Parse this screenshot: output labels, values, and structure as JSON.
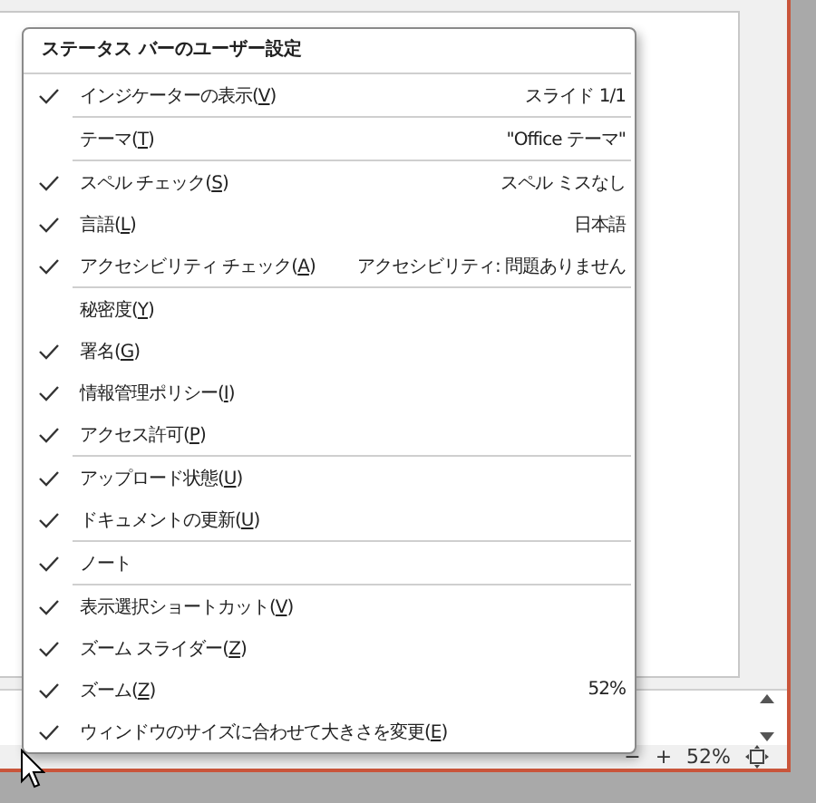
{
  "menu": {
    "title": "ステータス バーのユーザー設定",
    "groups": [
      {
        "items": [
          {
            "before": "インジケーターの表示(",
            "key": "V",
            "after": ")",
            "checked": true,
            "value": "スライド 1/1"
          }
        ]
      },
      {
        "items": [
          {
            "before": "テーマ(",
            "key": "T",
            "after": ")",
            "checked": false,
            "value": "\"Office テーマ\""
          }
        ]
      },
      {
        "items": [
          {
            "before": "スペル チェック(",
            "key": "S",
            "after": ")",
            "checked": true,
            "value": "スペル ミスなし"
          },
          {
            "before": "言語(",
            "key": "L",
            "after": ")",
            "checked": true,
            "value": "日本語"
          },
          {
            "before": "アクセシビリティ チェック(",
            "key": "A",
            "after": ")",
            "checked": true,
            "value": "アクセシビリティ: 問題ありません"
          }
        ]
      },
      {
        "items": [
          {
            "before": "秘密度(",
            "key": "Y",
            "after": ")",
            "checked": false
          },
          {
            "before": "署名(",
            "key": "G",
            "after": ")",
            "checked": true
          },
          {
            "before": "情報管理ポリシー(",
            "key": "I",
            "after": ")",
            "checked": true
          },
          {
            "before": "アクセス許可(",
            "key": "P",
            "after": ")",
            "checked": true
          }
        ]
      },
      {
        "items": [
          {
            "before": "アップロード状態(",
            "key": "U",
            "after": ")",
            "checked": true
          },
          {
            "before": "ドキュメントの更新(",
            "key": "U",
            "after": ")",
            "checked": true
          }
        ]
      },
      {
        "items": [
          {
            "before": "ノート",
            "checked": true
          }
        ]
      },
      {
        "items": [
          {
            "before": "表示選択ショートカット(",
            "key": "V",
            "after": ")",
            "checked": true
          },
          {
            "before": "ズーム スライダー(",
            "key": "Z",
            "after": ")",
            "checked": true
          },
          {
            "before": "ズーム(",
            "key": "Z",
            "after": ")",
            "checked": true,
            "value": "52%"
          },
          {
            "before": "ウィンドウのサイズに合わせて大きさを変更(",
            "key": "E",
            "after": ")",
            "checked": true
          }
        ]
      }
    ]
  },
  "status_bar": {
    "zoom_minus": "−",
    "zoom_plus": "+",
    "zoom": "52%"
  }
}
